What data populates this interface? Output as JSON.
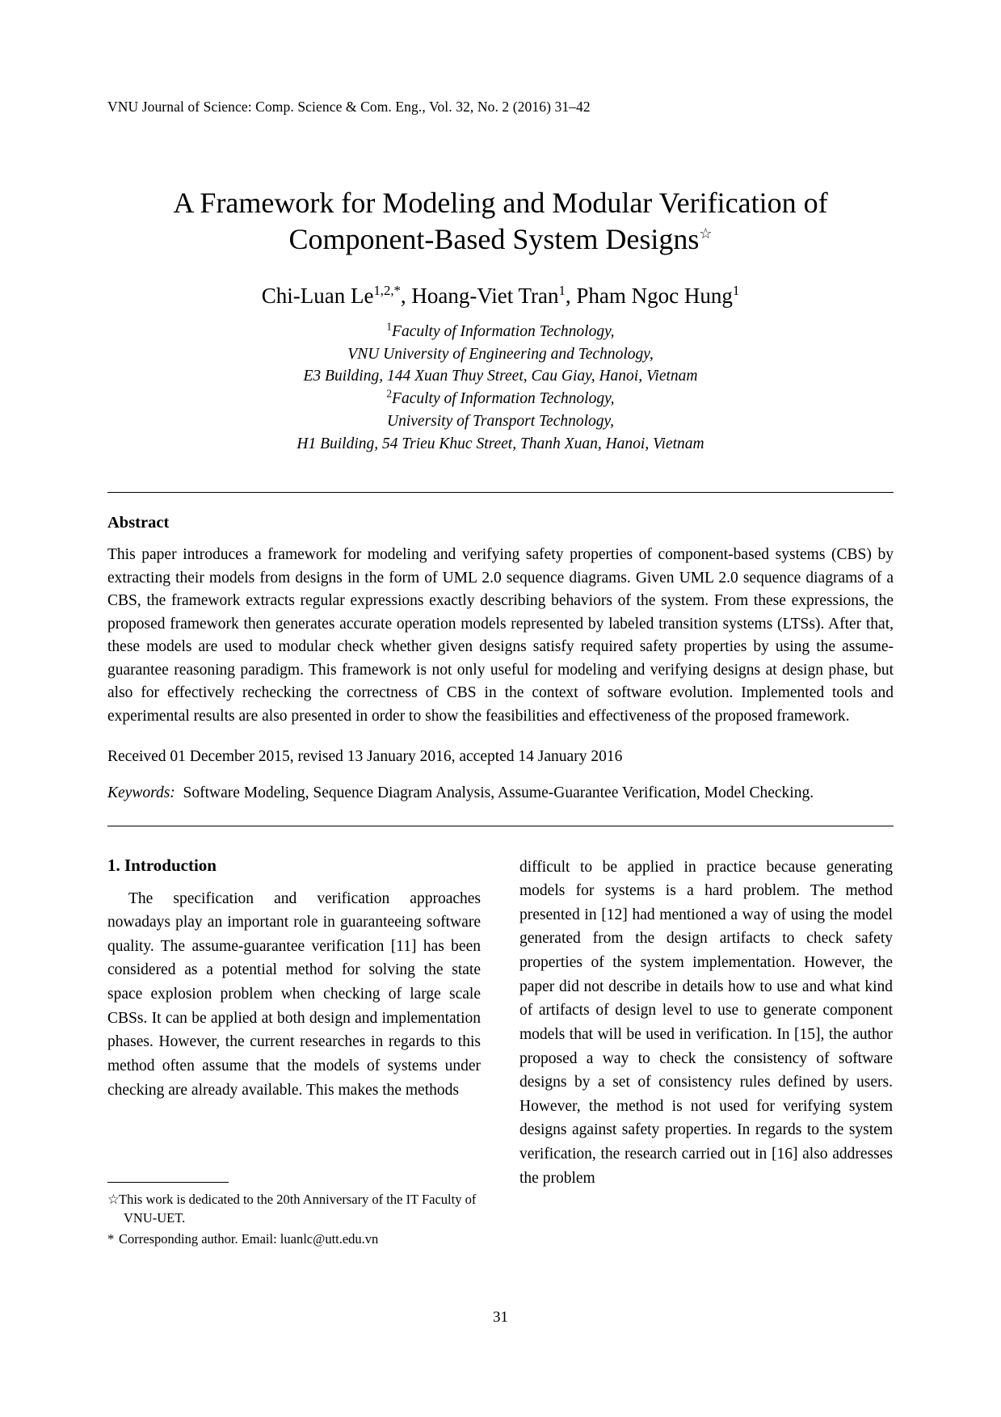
{
  "running_head": "VNU Journal of Science: Comp. Science & Com. Eng., Vol. 32, No. 2 (2016) 31–42",
  "title": {
    "line1": "A Framework for Modeling and Modular Verification of",
    "line2": "Component-Based System Designs",
    "footnote_marker": "☆"
  },
  "authors": {
    "a1_name": "Chi-Luan Le",
    "a1_sup": "1,2,*",
    "sep1": ", ",
    "a2_name": "Hoang-Viet Tran",
    "a2_sup": "1",
    "sep2": ", ",
    "a3_name": "Pham Ngoc Hung",
    "a3_sup": "1"
  },
  "affiliations": [
    {
      "sup": "1",
      "text": "Faculty of Information Technology,"
    },
    {
      "sup": "",
      "text": "VNU University of Engineering and Technology,"
    },
    {
      "sup": "",
      "text": "E3 Building, 144 Xuan Thuy Street, Cau Giay, Hanoi, Vietnam"
    },
    {
      "sup": "2",
      "text": "Faculty of Information Technology,"
    },
    {
      "sup": "",
      "text": "University of Transport Technology,"
    },
    {
      "sup": "",
      "text": "H1 Building, 54 Trieu Khuc Street, Thanh Xuan, Hanoi, Vietnam"
    }
  ],
  "abstract": {
    "heading": "Abstract",
    "body": "This paper introduces a framework for modeling and verifying safety properties of component-based systems (CBS) by extracting their models from designs in the form of UML 2.0 sequence diagrams. Given UML 2.0 sequence diagrams of a CBS, the framework extracts regular expressions exactly describing behaviors of the system. From these expressions, the proposed framework then generates accurate operation models represented by labeled transition systems (LTSs). After that, these models are used to modular check whether given designs satisfy required safety properties by using the assume-guarantee reasoning paradigm. This framework is not only useful for modeling and verifying designs at design phase, but also for effectively rechecking the correctness of CBS in the context of software evolution. Implemented tools and experimental results are also presented in order to show the feasibilities and effectiveness of the proposed framework."
  },
  "received": "Received 01 December 2015, revised 13 January 2016, accepted 14 January 2016",
  "keywords": {
    "label": "Keywords:",
    "value": "Software Modeling, Sequence Diagram Analysis, Assume-Guarantee Verification, Model Checking."
  },
  "body": {
    "section1_heading": "1.  Introduction",
    "left_para1": "The specification and verification approaches nowadays play an important role in guaranteeing software quality. The assume-guarantee verification [11] has been considered as a potential method for solving the state space explosion problem when checking of large scale CBSs. It can be applied at both design and implementation phases. However, the current researches in regards to this method often assume that the models of systems under checking are already available. This makes the methods",
    "right_para1": "difficult to be applied in practice because generating models for systems is a hard problem. The method presented in [12] had mentioned a way of using the model generated from the design artifacts to check safety properties of the system implementation. However, the paper did not describe in details how to use and what kind of artifacts of design level to use to generate component models that will be used in verification. In [15], the author proposed a way to check the consistency of software designs by a set of consistency rules defined by users. However, the method is not used for verifying system designs against safety properties. In regards to the system verification, the research carried out in [16] also addresses the problem"
  },
  "footnotes": [
    {
      "mark": "☆",
      "text": "This work is dedicated to the 20th Anniversary of the IT Faculty of VNU-UET."
    },
    {
      "mark": "*",
      "text": "Corresponding author. Email: luanlc@utt.edu.vn"
    }
  ],
  "page_number": "31"
}
